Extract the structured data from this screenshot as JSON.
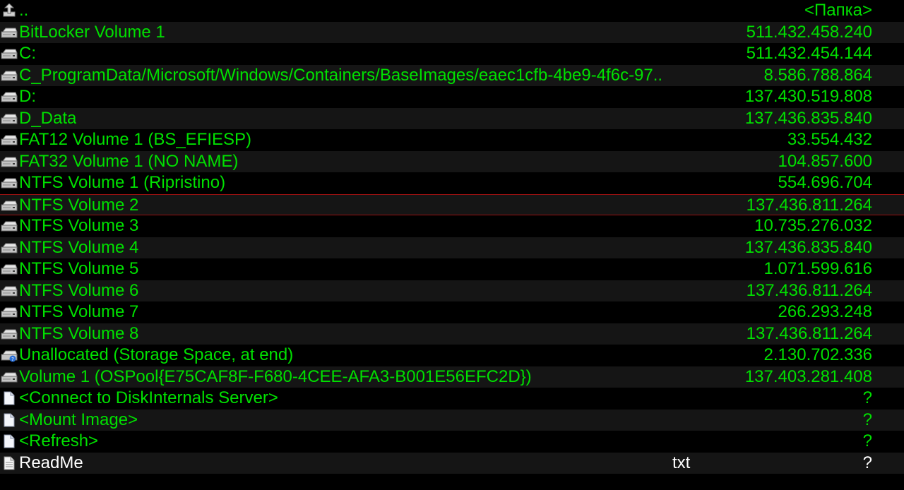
{
  "colors": {
    "background": "#000000",
    "alt_row": "#151515",
    "text": "#00e000",
    "readme_text": "#ffffff",
    "selection_border": "#9a1010"
  },
  "rows": [
    {
      "name": "..",
      "ext": "",
      "size": "<Папка>",
      "icon": "up-folder-icon"
    },
    {
      "name": "BitLocker Volume 1",
      "ext": "",
      "size": "511.432.458.240",
      "icon": "drive-icon"
    },
    {
      "name": "C:",
      "ext": "",
      "size": "511.432.454.144",
      "icon": "drive-icon"
    },
    {
      "name": "C_ProgramData/Microsoft/Windows/Containers/BaseImages/eaec1cfb-4be9-4f6c-97..",
      "ext": "",
      "size": "8.586.788.864",
      "icon": "drive-icon"
    },
    {
      "name": "D:",
      "ext": "",
      "size": "137.430.519.808",
      "icon": "drive-icon"
    },
    {
      "name": "D_Data",
      "ext": "",
      "size": "137.436.835.840",
      "icon": "drive-icon"
    },
    {
      "name": "FAT12 Volume 1 (BS_EFIESP)",
      "ext": "",
      "size": "33.554.432",
      "icon": "drive-icon"
    },
    {
      "name": "FAT32 Volume 1 (NO NAME)",
      "ext": "",
      "size": "104.857.600",
      "icon": "drive-icon"
    },
    {
      "name": "NTFS Volume 1 (Ripristino)",
      "ext": "",
      "size": "554.696.704",
      "icon": "drive-icon"
    },
    {
      "name": "NTFS Volume 2",
      "ext": "",
      "size": "137.436.811.264",
      "icon": "drive-icon"
    },
    {
      "name": "NTFS Volume 3",
      "ext": "",
      "size": "10.735.276.032",
      "icon": "drive-icon"
    },
    {
      "name": "NTFS Volume 4",
      "ext": "",
      "size": "137.436.835.840",
      "icon": "drive-icon"
    },
    {
      "name": "NTFS Volume 5",
      "ext": "",
      "size": "1.071.599.616",
      "icon": "drive-icon"
    },
    {
      "name": "NTFS Volume 6",
      "ext": "",
      "size": "137.436.811.264",
      "icon": "drive-icon"
    },
    {
      "name": "NTFS Volume 7",
      "ext": "",
      "size": "266.293.248",
      "icon": "drive-icon"
    },
    {
      "name": "NTFS Volume 8",
      "ext": "",
      "size": "137.436.811.264",
      "icon": "drive-icon"
    },
    {
      "name": "Unallocated (Storage Space, at end)",
      "ext": "",
      "size": "2.130.702.336",
      "icon": "drive-unknown-icon"
    },
    {
      "name": "Volume 1 (OSPool{E75CAF8F-F680-4CEE-AFA3-B001E56EFC2D})",
      "ext": "",
      "size": "137.403.281.408",
      "icon": "drive-icon"
    },
    {
      "name": "<Connect to DiskInternals Server>",
      "ext": "",
      "size": "?",
      "icon": "file-icon"
    },
    {
      "name": "<Mount Image>",
      "ext": "",
      "size": "?",
      "icon": "file-icon"
    },
    {
      "name": "<Refresh>",
      "ext": "",
      "size": "?",
      "icon": "file-icon"
    },
    {
      "name": "ReadMe",
      "ext": "txt",
      "size": "?",
      "icon": "text-file-icon"
    }
  ]
}
